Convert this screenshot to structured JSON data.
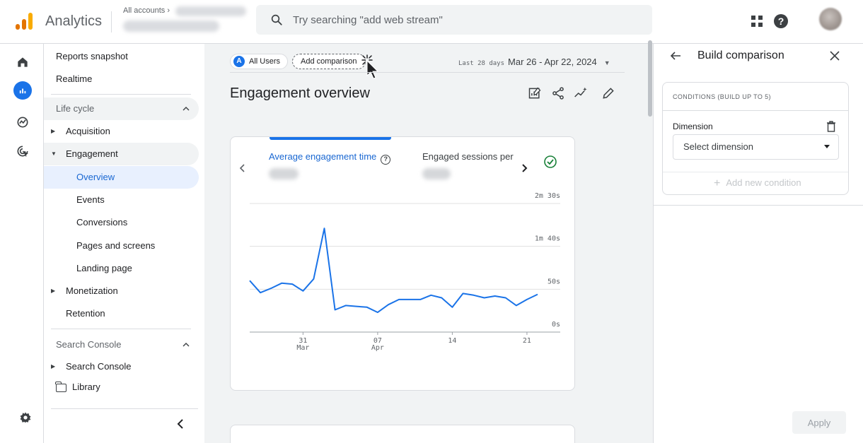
{
  "header": {
    "app_name": "Analytics",
    "account_label": "All accounts ›",
    "search_placeholder": "Try searching \"add web stream\""
  },
  "nav": {
    "reports_snapshot": "Reports snapshot",
    "realtime": "Realtime",
    "life_cycle": "Life cycle",
    "acquisition": "Acquisition",
    "engagement": "Engagement",
    "overview": "Overview",
    "events": "Events",
    "conversions": "Conversions",
    "pages_and_screens": "Pages and screens",
    "landing_page": "Landing page",
    "monetization": "Monetization",
    "retention": "Retention",
    "search_console_header": "Search Console",
    "search_console_item": "Search Console",
    "library": "Library"
  },
  "main": {
    "chip_users_badge": "A",
    "chip_users": "All Users",
    "chip_compare": "Add comparison",
    "date_prefix": "Last 28 days",
    "date_range": "Mar 26 - Apr 22, 2024",
    "title": "Engagement overview",
    "metric1_label": "Average engagement time",
    "metric2_label": "Engaged sessions per"
  },
  "chart_data": {
    "type": "line",
    "y_tick_labels": [
      "0s",
      "50s",
      "1m 40s",
      "2m 30s"
    ],
    "y_ticks_seconds": [
      0,
      50,
      100,
      150
    ],
    "ylim": [
      0,
      150
    ],
    "x_tick_labels": [
      {
        "index": 5,
        "day": "31",
        "month": "Mar"
      },
      {
        "index": 12,
        "day": "07",
        "month": "Apr"
      },
      {
        "index": 19,
        "day": "14",
        "month": ""
      },
      {
        "index": 26,
        "day": "21",
        "month": ""
      }
    ],
    "x_dates": [
      "Mar 26",
      "Mar 27",
      "Mar 28",
      "Mar 29",
      "Mar 30",
      "Mar 31",
      "Apr 01",
      "Apr 02",
      "Apr 03",
      "Apr 04",
      "Apr 05",
      "Apr 06",
      "Apr 07",
      "Apr 08",
      "Apr 09",
      "Apr 10",
      "Apr 11",
      "Apr 12",
      "Apr 13",
      "Apr 14",
      "Apr 15",
      "Apr 16",
      "Apr 17",
      "Apr 18",
      "Apr 19",
      "Apr 20",
      "Apr 21",
      "Apr 22"
    ],
    "values": [
      60,
      46,
      51,
      57,
      56,
      48,
      62,
      121,
      26,
      31,
      30,
      29,
      23,
      32,
      38,
      38,
      38,
      43,
      40,
      29,
      45,
      43,
      40,
      42,
      40,
      31,
      38,
      44
    ],
    "series_color": "#1a73e8",
    "grid": true
  },
  "panel": {
    "title": "Build comparison",
    "conditions_title": "CONDITIONS (BUILD UP TO 5)",
    "dimension_label": "Dimension",
    "select_dimension": "Select dimension",
    "add_condition": "Add new condition",
    "apply": "Apply"
  },
  "colors": {
    "accent": "#1a73e8",
    "active_nav_bg": "#e8f0fe",
    "logo_orange": "#e37400",
    "logo_yellow": "#f9ab00"
  }
}
